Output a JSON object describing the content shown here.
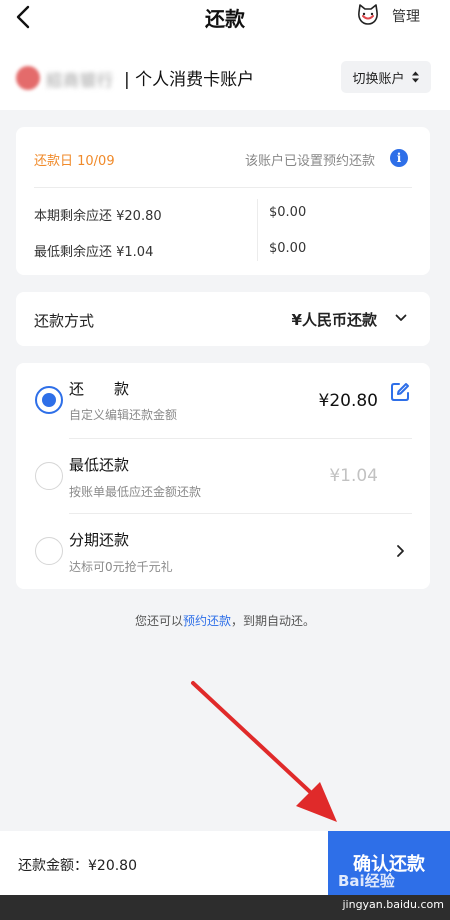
{
  "header": {
    "title": "还款",
    "manage_label": "管理"
  },
  "account": {
    "bank_name": "招商银行",
    "type": "| 个人消费卡账户",
    "switch_label": "切换账户"
  },
  "bill": {
    "due_date": "还款日 10/09",
    "preset_note": "该账户已设置预约还款",
    "rows": [
      {
        "label": "本期剩余应还 ¥20.80",
        "value": "$0.00"
      },
      {
        "label": "最低剩余应还 ¥1.04",
        "value": "$0.00"
      }
    ]
  },
  "method": {
    "label": "还款方式",
    "value": "¥人民币还款"
  },
  "options": [
    {
      "title": "还款",
      "sub": "自定义编辑还款金额",
      "amount": "¥20.80",
      "selected": true
    },
    {
      "title": "最低还款",
      "sub": "按账单最低应还金额还款",
      "amount": "¥1.04",
      "selected": false
    },
    {
      "title": "分期还款",
      "sub": "达标可0元抢千元礼",
      "selected": false
    }
  ],
  "preset_line": {
    "prefix": "您还可以",
    "link": "预约还款",
    "suffix": "，到期自动还。"
  },
  "footer": {
    "total_label": "还款金额：",
    "total_value": "¥20.80",
    "confirm_label": "确认还款"
  },
  "watermark": {
    "logo": "Bai经验",
    "site": "jingyan.baidu.com"
  },
  "colors": {
    "accent": "#2e6fe8",
    "due_orange": "#f08a2a",
    "annotation_arrow": "#e02a2a"
  }
}
